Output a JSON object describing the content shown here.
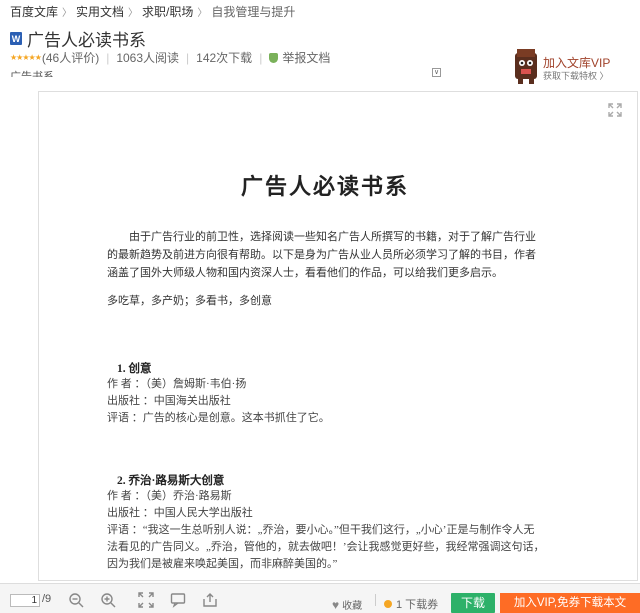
{
  "breadcrumb": [
    "百度文库",
    "实用文档",
    "求职/职场",
    "自我管理与提升"
  ],
  "doc": {
    "title": "广告人必读书系",
    "rating_stars": "★★★★★",
    "rating_count": "(46人评价)",
    "reads": "1063人阅读",
    "downloads": "142次下载",
    "report": "举报文档",
    "truncated_label": "广告书系"
  },
  "vip_promo": {
    "title": "加入文库VIP",
    "subtitle": "获取下载特权 〉"
  },
  "content": {
    "heading": "广告人必读书系",
    "intro": "由于广告行业的前卫性，选择阅读一些知名广告人所撰写的书籍，对于了解广告行业的最新趋势及前进方向很有帮助。以下是身为广告从业人员所必须学习了解的书目，作者涵盖了国外大师级人物和国内资深人士，看看他们的作品，可以给我们更多启示。",
    "motto": "多吃草，多产奶；多看书，多创意",
    "books": [
      {
        "title": "1. 创意",
        "lines": [
          "作 者 ：（美）詹姆斯·韦伯·扬",
          "出版社 ：中国海关出版社",
          "评语 ：广告的核心是创意。这本书抓住了它。"
        ]
      },
      {
        "title": "2. 乔治·路易斯大创意",
        "lines": [
          "作 者 ：（美）乔治·路易斯",
          "出版社 ：中国人民大学出版社",
          "评语 ：“我这一生总听别人说：„乔治，要小心。”但干我们这行，„小心’正是与制作令人无法看见的广告同义。„乔治，管他的，就去做吧！’会让我感觉更好些，我经常强调这句话，因为我们是被雇来唤起美国，而非麻醉美国的。”"
        ]
      }
    ]
  },
  "toolbar": {
    "page_current": "1",
    "page_total": "/9",
    "favorite": "收藏",
    "coupon": "1 下载券",
    "download": "下载",
    "vip_download": "加入VIP,免券下载本文"
  },
  "colors": {
    "download_green": "#2db169",
    "vip_orange": "#fe6c25",
    "star_orange": "#f5a623",
    "vip_text": "#a0422a"
  }
}
